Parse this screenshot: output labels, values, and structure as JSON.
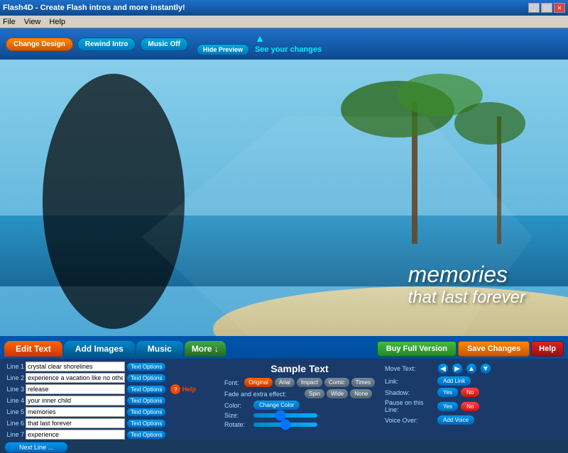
{
  "titleBar": {
    "title": "Flash4D - Create Flash intros and more instantly!",
    "controls": [
      "minimize",
      "maximize",
      "close"
    ]
  },
  "menuBar": {
    "items": [
      "File",
      "View",
      "Help"
    ]
  },
  "toolbar": {
    "changeDesign": "Change Design",
    "rewindIntro": "Rewind Intro",
    "musicOff": "Music Off",
    "hidePreview": "Hide Preview",
    "seeChanges": "See your changes"
  },
  "previewText": {
    "line1": "memories",
    "line2": "that last forever"
  },
  "tabs": {
    "editText": "Edit Text",
    "addImages": "Add Images",
    "music": "Music",
    "more": "More ↓",
    "buyFullVersion": "Buy Full Version",
    "saveChanges": "Save Changes",
    "help": "Help"
  },
  "textLines": [
    {
      "label": "Line 1",
      "value": "crystal clear shorelines"
    },
    {
      "label": "Line 2",
      "value": "experience a vacation like no other"
    },
    {
      "label": "Line 3",
      "value": "release"
    },
    {
      "label": "Line 4",
      "value": "your inner child"
    },
    {
      "label": "Line 5",
      "value": "memories"
    },
    {
      "label": "Line 6",
      "value": "that last forever"
    },
    {
      "label": "Line 7",
      "value": "experience"
    }
  ],
  "textOptionsBtn": "Text Options",
  "nextLineBtn": "Next Line ...",
  "helpBadge": "?",
  "helpLabel": "Help",
  "sampleText": {
    "title": "Sample Text",
    "fontLabel": "Font:",
    "fonts": [
      "Original",
      "Arial",
      "Impact",
      "Comic",
      "Times"
    ],
    "fadeLabel": "Fade and extra effect:",
    "effects": [
      "Spin",
      "Wide",
      "None"
    ],
    "colorLabel": "Color:",
    "colorBtn": "Change Color",
    "sizeLabel": "Size:",
    "rotateLabel": "Rotate:"
  },
  "moveText": {
    "label": "Move Text:",
    "arrows": [
      "◀",
      "▶",
      "▲",
      "▼"
    ]
  },
  "link": {
    "label": "Link:",
    "btn": "Add Link"
  },
  "shadow": {
    "label": "Shadow:",
    "yes": "Yes",
    "no": "No"
  },
  "pauseOnLine": {
    "label": "Pause on this Line:",
    "yes": "Yes",
    "no": "No"
  },
  "voiceOver": {
    "label": "Voice Over:",
    "btn": "Add Voice"
  }
}
